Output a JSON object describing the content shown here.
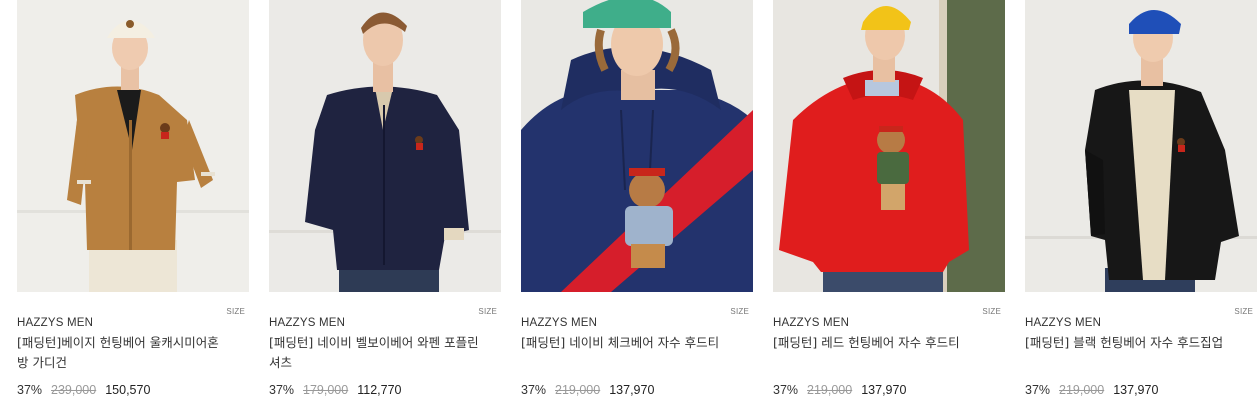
{
  "products": [
    {
      "size_label": "SIZE",
      "brand": "HAZZYS MEN",
      "name": "[패딩턴]베이지 헌팅베어 울캐시미어혼방 가디건",
      "discount": "37%",
      "original_price": "239,000",
      "sale_price": "150,570"
    },
    {
      "size_label": "SIZE",
      "brand": "HAZZYS MEN",
      "name": "[패딩턴] 네이비 벨보이베어 와펜 포플린 셔츠",
      "discount": "37%",
      "original_price": "179,000",
      "sale_price": "112,770"
    },
    {
      "size_label": "SIZE",
      "brand": "HAZZYS MEN",
      "name": "[패딩턴] 네이비 체크베어 자수 후드티",
      "discount": "37%",
      "original_price": "219,000",
      "sale_price": "137,970"
    },
    {
      "size_label": "SIZE",
      "brand": "HAZZYS MEN",
      "name": "[패딩턴] 레드 헌팅베어 자수 후드티",
      "discount": "37%",
      "original_price": "219,000",
      "sale_price": "137,970"
    },
    {
      "size_label": "SIZE",
      "brand": "HAZZYS MEN",
      "name": "[패딩턴] 블랙 헌팅베어 자수 후드집업",
      "discount": "37%",
      "original_price": "219,000",
      "sale_price": "137,970"
    }
  ],
  "colors": {
    "cardigan": "#b8803f",
    "navy_shirt": "#1f2340",
    "navy_hoodie": "#23336d",
    "red_hoodie": "#e01d1d",
    "black_hoodie": "#171717",
    "photo_bg": "#ecebe8"
  }
}
